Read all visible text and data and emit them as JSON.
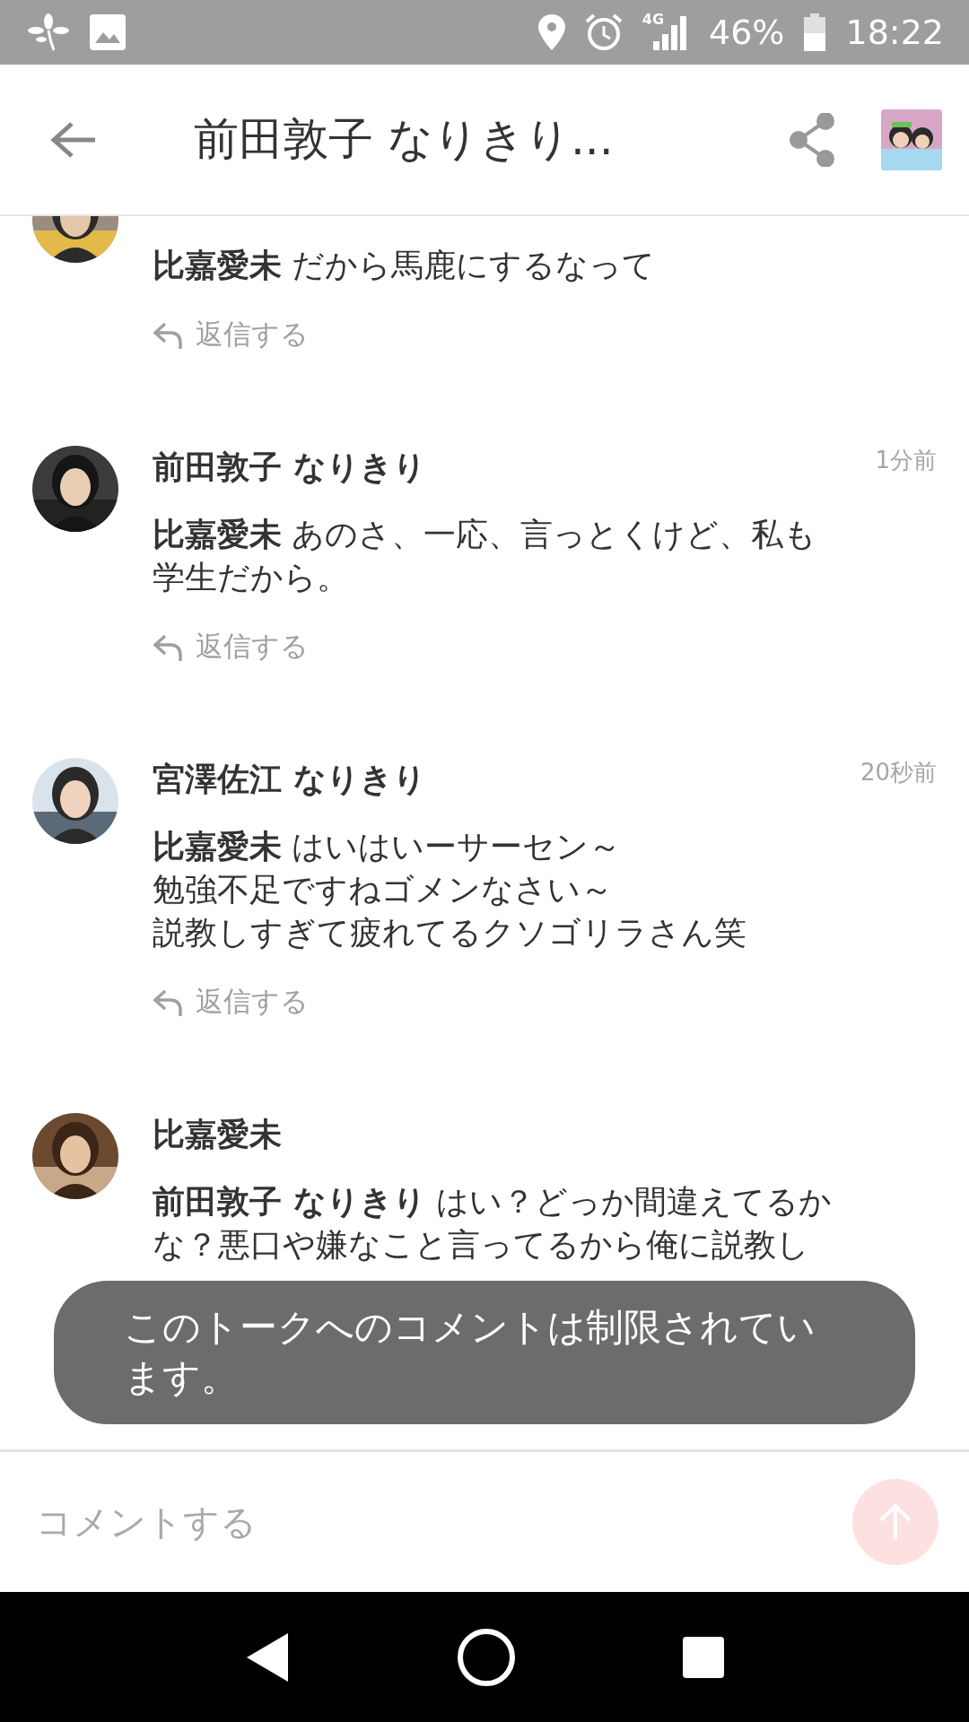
{
  "status_bar": {
    "network": "4G",
    "battery": "46%",
    "time": "18:22"
  },
  "header": {
    "title": "前田敦子 なりきり..."
  },
  "comments": [
    {
      "lines": [
        "**比嘉愛未** だから馬鹿にするなって"
      ],
      "reply": "返信する"
    },
    {
      "author": "前田敦子 なりきり",
      "time": "1分前",
      "lines": [
        "**比嘉愛未** あのさ、一応、言っとくけど、私も",
        "学生だから。"
      ],
      "reply": "返信する"
    },
    {
      "author": "宮澤佐江 なりきり",
      "time": "20秒前",
      "lines": [
        "**比嘉愛未** はいはいーサーセン～",
        "勉強不足ですねゴメンなさい～",
        "説教しすぎて疲れてるクソゴリラさん笑"
      ],
      "reply": "返信する"
    },
    {
      "author": "比嘉愛未",
      "lines": [
        "**前田敦子 なりきり** はい？どっか間違えてるか",
        "な？悪口や嫌なこと言ってるから俺に説教し"
      ]
    }
  ],
  "toast": {
    "text": "このトークへのコメントは制限されています。"
  },
  "composer": {
    "placeholder": "コメントする",
    "send_disabled": true
  }
}
